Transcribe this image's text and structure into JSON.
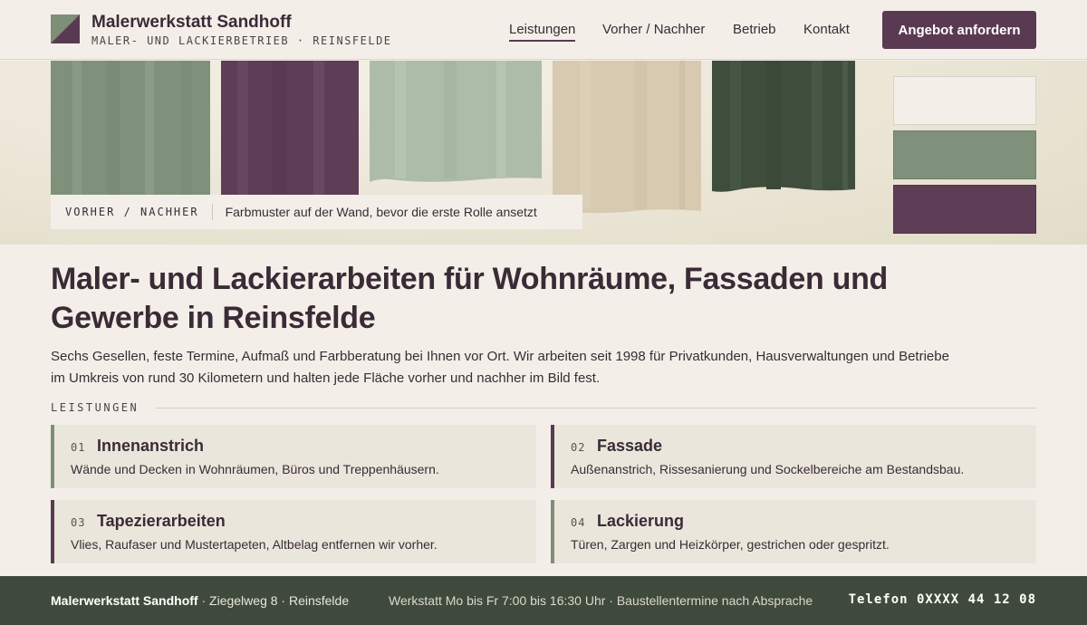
{
  "header": {
    "brand_name": "Malerwerkstatt Sandhoff",
    "brand_sub": "MALER- UND LACKIERBETRIEB · REINSFELDE",
    "nav": [
      {
        "label": "Leistungen",
        "active": true
      },
      {
        "label": "Vorher / Nachher",
        "active": false
      },
      {
        "label": "Betrieb",
        "active": false
      },
      {
        "label": "Kontakt",
        "active": false
      }
    ],
    "cta_label": "Angebot anfordern"
  },
  "hero": {
    "caption_tag": "VORHER / NACHHER",
    "caption_text": "Farbmuster auf der Wand, bevor die erste Rolle ansetzt",
    "panels": [
      {
        "name": "sage",
        "color": "#7f917a"
      },
      {
        "name": "plum",
        "color": "#5e3d57"
      },
      {
        "name": "mint",
        "color": "#adbca8"
      },
      {
        "name": "sand",
        "color": "#d8cab1"
      },
      {
        "name": "forest",
        "color": "#3f4e3c"
      }
    ],
    "swatches": [
      {
        "name": "cream",
        "color": "#f3efe8"
      },
      {
        "name": "sage",
        "color": "#7f917a"
      },
      {
        "name": "plum",
        "color": "#5e3d57"
      }
    ]
  },
  "main": {
    "headline": "Maler- und Lackierarbeiten für Wohnräume, Fassaden und Gewerbe in Reinsfelde",
    "intro": "Sechs Gesellen, feste Termine, Aufmaß und Farbberatung bei Ihnen vor Ort. Wir arbeiten seit 1998 für Privatkunden, Hausverwaltungen und Betriebe im Umkreis von rund 30 Kilometern und halten jede Fläche vorher und nachher im Bild fest.",
    "section_label": "LEISTUNGEN",
    "services": [
      {
        "num": "01",
        "title": "Innenanstrich",
        "desc": "Wände und Decken in Wohnräumen, Büros und Treppenhäusern."
      },
      {
        "num": "02",
        "title": "Fassade",
        "desc": "Außenanstrich, Rissesanierung und Sockelbereiche am Bestandsbau."
      },
      {
        "num": "03",
        "title": "Tapezierarbeiten",
        "desc": "Vlies, Raufaser und Mustertapeten, Altbelag entfernen wir vorher."
      },
      {
        "num": "04",
        "title": "Lackierung",
        "desc": "Türen, Zargen und Heizkörper, gestrichen oder gespritzt."
      }
    ]
  },
  "footer": {
    "company": "Malerwerkstatt Sandhoff",
    "address": " · Ziegelweg 8 · Reinsfelde",
    "hours": "Werkstatt Mo bis Fr 7:00 bis 16:30 Uhr · Baustellentermine nach Absprache",
    "phone": "Telefon 0XXXX 44 12 08"
  },
  "colors": {
    "accent": "#5a3a52",
    "sage": "#7e8f78",
    "footer_bg": "#404a3c",
    "background": "#f3efe8"
  }
}
